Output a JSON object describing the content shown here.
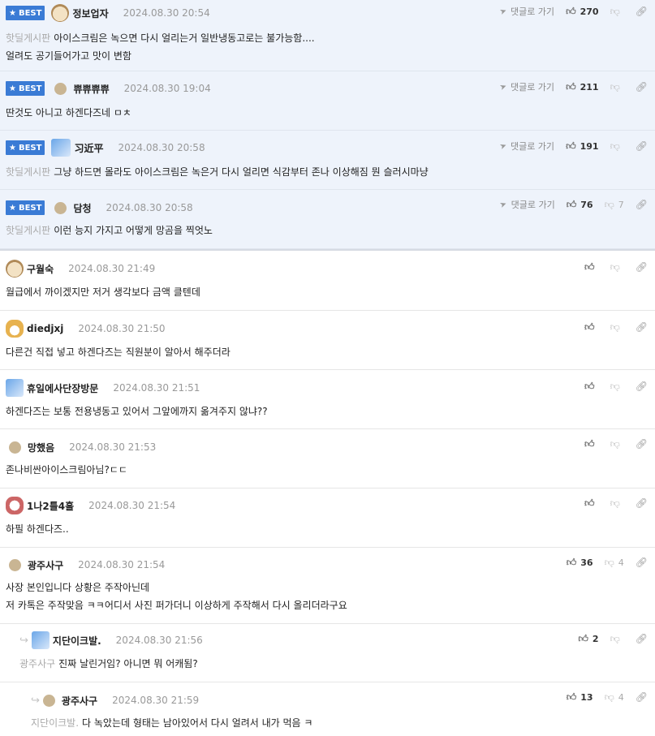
{
  "labels": {
    "best": "BEST",
    "goto_reply": "댓글로 가기"
  },
  "comments": [
    {
      "best": true,
      "avatar": "dog-avatar",
      "nick": "정보업자",
      "date": "2024.08.30 20:54",
      "board": "핫딜게시판",
      "lines": [
        "아이스크림은 녹으면 다시 얼리는거 일반냉동고로는 불가능함....",
        "얼려도 공기들어가고 맛이 변함"
      ],
      "likes": "270",
      "dislikes": ""
    },
    {
      "best": true,
      "avatar": "dot-avatar",
      "nick": "쀼쀼쀼쀼",
      "date": "2024.08.30 19:04",
      "board": "",
      "lines": [
        "딴것도 아니고 하겐다즈네 ㅁㅊ"
      ],
      "likes": "211",
      "dislikes": ""
    },
    {
      "best": true,
      "avatar": "blue-avatar",
      "nick": "习近平",
      "date": "2024.08.30 20:58",
      "board": "핫딜게시판",
      "lines": [
        "그냥 하드면 몰라도 아이스크림은 녹은거 다시 얼리면 식감부터 존나 이상해짐 뭔 슬러시마냥"
      ],
      "likes": "191",
      "dislikes": ""
    },
    {
      "best": true,
      "avatar": "dot-avatar",
      "nick": "담청",
      "date": "2024.08.30 20:58",
      "board": "핫딜게시판",
      "lines": [
        "이런 능지 가지고 어떻게 망곰을 찍엇노"
      ],
      "likes": "76",
      "dislikes": "7"
    },
    {
      "best": false,
      "avatar": "dog-avatar",
      "nick": "구월숙",
      "date": "2024.08.30 21:49",
      "lines": [
        "월급에서 까이겠지만 저거 생각보다 금액 클텐데"
      ],
      "likes": "",
      "dislikes": ""
    },
    {
      "best": false,
      "avatar": "fox-avatar",
      "nick": "diedjxj",
      "date": "2024.08.30 21:50",
      "lines": [
        "다른건 직접 넣고 하겐다즈는 직원분이 알아서 해주더라"
      ],
      "likes": "",
      "dislikes": ""
    },
    {
      "best": false,
      "avatar": "blue-avatar",
      "nick": "휴일에사단장방문",
      "date": "2024.08.30 21:51",
      "lines": [
        "하겐다즈는 보통 전용냉동고 있어서 그앞에까지 옮겨주지 않냐??"
      ],
      "likes": "",
      "dislikes": ""
    },
    {
      "best": false,
      "avatar": "dot-avatar",
      "nick": "망했음",
      "date": "2024.08.30 21:53",
      "lines": [
        "존나비싼아이스크림아님?ㄷㄷ"
      ],
      "likes": "",
      "dislikes": ""
    },
    {
      "best": false,
      "avatar": "face-avatar",
      "nick": "1나2틀4흘",
      "date": "2024.08.30 21:54",
      "lines": [
        "하필 하겐다즈.."
      ],
      "likes": "",
      "dislikes": ""
    },
    {
      "best": false,
      "avatar": "dot-avatar",
      "nick": "광주사구",
      "date": "2024.08.30 21:54",
      "lines": [
        "사장 본인입니다 상황은 주작아닌데",
        "저 카톡은 주작맞음 ㅋㅋ어디서 사진 퍼가더니 이상하게 주작해서 다시 올리더라구요"
      ],
      "likes": "36",
      "dislikes": "4"
    },
    {
      "best": false,
      "reply": true,
      "avatar": "blue-avatar",
      "nick": "지단이크발.",
      "date": "2024.08.30 21:56",
      "reply_to": "광주사구",
      "lines": [
        "진짜 날린거임? 아니면 뭐 어캐됨?"
      ],
      "likes": "2",
      "dislikes": ""
    },
    {
      "best": false,
      "reply": true,
      "avatar": "dot-avatar",
      "nick": "광주사구",
      "date": "2024.08.30 21:59",
      "reply_to": "지단이크발.",
      "lines": [
        "다 녹았는데 형태는 남아있어서 다시 얼려서 내가 먹음 ㅋ"
      ],
      "likes": "13",
      "dislikes": "4"
    }
  ],
  "colors": {
    "best_bg": "#eef3fb",
    "badge": "#3a7bd5",
    "muted": "#999999"
  }
}
